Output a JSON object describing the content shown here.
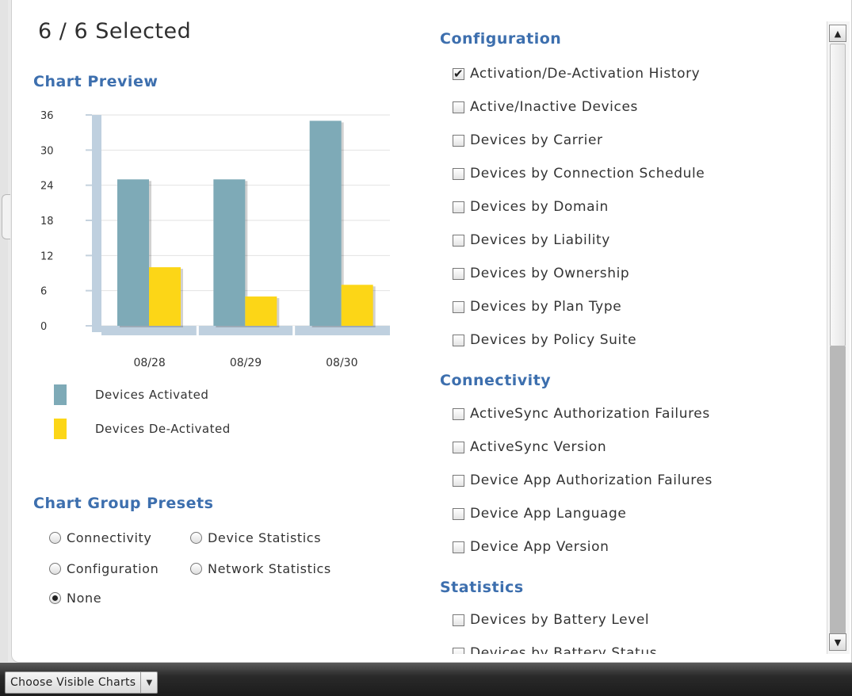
{
  "header": {
    "selected_count": "6 / 6 Selected"
  },
  "chart_preview": {
    "heading": "Chart Preview",
    "legend": [
      {
        "label": "Devices Activated",
        "color": "#7eaab7"
      },
      {
        "label": "Devices De-Activated",
        "color": "#fcd617"
      }
    ]
  },
  "chart_data": {
    "type": "bar",
    "categories": [
      "08/28",
      "08/29",
      "08/30"
    ],
    "series": [
      {
        "name": "Devices Activated",
        "values": [
          25,
          25,
          35
        ]
      },
      {
        "name": "Devices De-Activated",
        "values": [
          10,
          5,
          7
        ]
      }
    ],
    "yticks": [
      "36",
      "30",
      "24",
      "18",
      "12",
      "6",
      "0"
    ],
    "ylim": [
      0,
      36
    ],
    "grid": true,
    "legend_position": "bottom-left"
  },
  "presets": {
    "heading": "Chart Group Presets",
    "options": [
      {
        "label": "Connectivity",
        "selected": false
      },
      {
        "label": "Device Statistics",
        "selected": false
      },
      {
        "label": "Configuration",
        "selected": false
      },
      {
        "label": "Network Statistics",
        "selected": false
      },
      {
        "label": "None",
        "selected": true
      }
    ]
  },
  "chart_list": {
    "groups": [
      {
        "heading": "Configuration",
        "items": [
          {
            "label": "Activation/De-Activation History",
            "checked": true
          },
          {
            "label": "Active/Inactive Devices",
            "checked": false
          },
          {
            "label": "Devices by Carrier",
            "checked": false
          },
          {
            "label": "Devices by Connection Schedule",
            "checked": false
          },
          {
            "label": "Devices by Domain",
            "checked": false
          },
          {
            "label": "Devices by Liability",
            "checked": false
          },
          {
            "label": "Devices by Ownership",
            "checked": false
          },
          {
            "label": "Devices by Plan Type",
            "checked": false
          },
          {
            "label": "Devices by Policy Suite",
            "checked": false
          }
        ]
      },
      {
        "heading": "Connectivity",
        "items": [
          {
            "label": "ActiveSync Authorization Failures",
            "checked": false
          },
          {
            "label": "ActiveSync Version",
            "checked": false
          },
          {
            "label": "Device App Authorization Failures",
            "checked": false
          },
          {
            "label": "Device App Language",
            "checked": false
          },
          {
            "label": "Device App Version",
            "checked": false
          }
        ]
      },
      {
        "heading": "Statistics",
        "items": [
          {
            "label": "Devices by Battery Level",
            "checked": false
          },
          {
            "label": "Devices by Battery Status",
            "checked": false
          }
        ]
      }
    ]
  },
  "footer": {
    "choose_visible_charts_label": "Choose Visible Charts"
  }
}
